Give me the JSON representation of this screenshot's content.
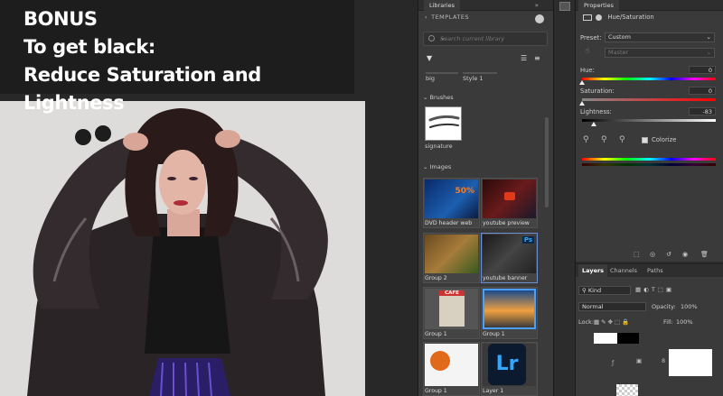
{
  "overlay": {
    "line1": "BONUS",
    "line2": "To get black:",
    "line3": "Reduce Saturation and Lightness"
  },
  "libraries": {
    "tab": "Libraries",
    "tab_extra": "»",
    "header": "TEMPLATES",
    "search_placeholder": "Search current library",
    "chips": [
      "big",
      "Style 1"
    ],
    "brushes_title": "Brushes",
    "brush_label": "signature",
    "images_title": "Images",
    "images": [
      {
        "label": "DVD header web"
      },
      {
        "label": "youtube preview"
      },
      {
        "label": "Group 2"
      },
      {
        "label": "youtube banner"
      },
      {
        "label": "Group 1"
      },
      {
        "label": "Group 1"
      },
      {
        "label": "Group 1"
      },
      {
        "label": "Layer 1"
      }
    ],
    "thumb_texts": {
      "sale": "50%",
      "cafe": "CAFE",
      "lr": "Lr",
      "ps": "Ps"
    }
  },
  "properties": {
    "tab": "Properties",
    "title": "Hue/Saturation",
    "preset_label": "Preset:",
    "preset_value": "Custom",
    "channel_value": "Master",
    "hue_label": "Hue:",
    "hue_value": "0",
    "saturation_label": "Saturation:",
    "saturation_value": "0",
    "lightness_label": "Lightness:",
    "lightness_value": "-83",
    "colorize_label": "Colorize",
    "lightness_fraction": 0.085
  },
  "layers": {
    "tabs": [
      "Layers",
      "Channels",
      "Paths"
    ],
    "kind": "Kind",
    "blend_mode": "Normal",
    "opacity_label": "Opacity:",
    "opacity_value": "100%",
    "lock_label": "Lock:",
    "fill_label": "Fill:",
    "fill_value": "100%"
  },
  "colors": {
    "panel_bg": "#3a3a3a",
    "canvas_bg": "#282828",
    "overlay_bg": "#1d1d1d",
    "overlay_text": "#ffffff"
  }
}
